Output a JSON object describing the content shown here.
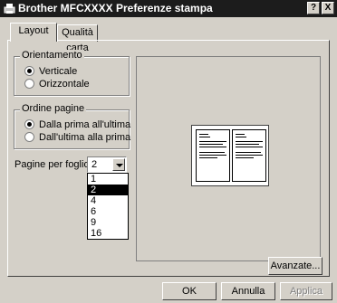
{
  "window": {
    "title": "Brother MFCXXXX Preferenze stampa",
    "help_button": "?",
    "close_button": "X"
  },
  "tabs": [
    {
      "label": "Layout",
      "active": true
    },
    {
      "label": "Qualità carta",
      "active": false
    }
  ],
  "orientation": {
    "legend": "Orientamento",
    "options": [
      {
        "label": "Verticale",
        "selected": true
      },
      {
        "label": "Orizzontale",
        "selected": false
      }
    ]
  },
  "page_order": {
    "legend": "Ordine pagine",
    "options": [
      {
        "label": "Dalla prima all'ultima",
        "selected": true
      },
      {
        "label": "Dall'ultima alla prima",
        "selected": false
      }
    ]
  },
  "pages_per_sheet": {
    "label": "Pagine per foglio:",
    "value": "2",
    "options": [
      "1",
      "2",
      "4",
      "6",
      "9",
      "16"
    ],
    "highlighted": "2"
  },
  "buttons": {
    "advanced": "Avanzate...",
    "ok": "OK",
    "cancel": "Annulla",
    "apply": "Applica"
  }
}
